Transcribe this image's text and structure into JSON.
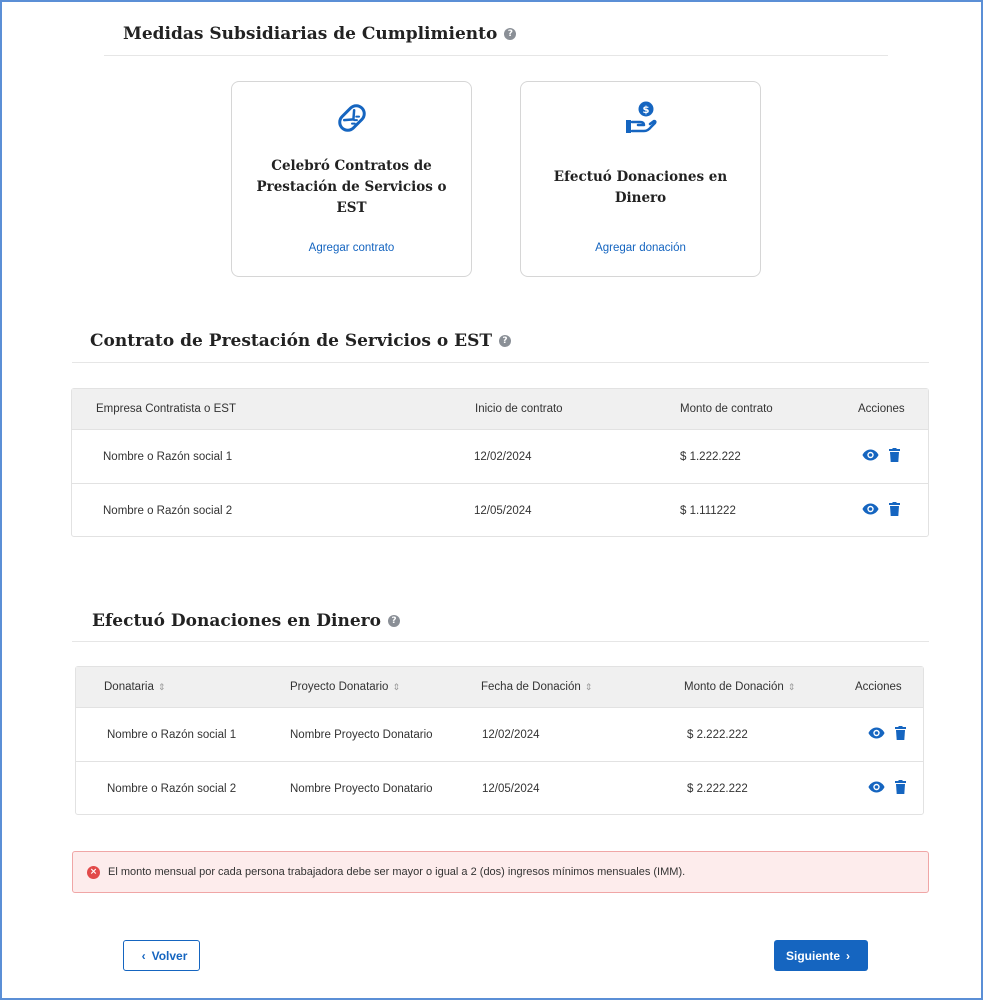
{
  "medidas": {
    "title": "Medidas Subsidiarias de Cumplimiento",
    "help_glyph": "?"
  },
  "cards": [
    {
      "title_lines": [
        "Celebró Contratos de",
        "Prestación de Servicios o",
        "EST"
      ],
      "link": "Agregar contrato",
      "icon": "handshake-icon"
    },
    {
      "title_lines": [
        "Efectuó Donaciones en",
        "Dinero"
      ],
      "link": "Agregar donación",
      "icon": "donation-hand-icon"
    }
  ],
  "contratos": {
    "title": "Contrato de Prestación de Servicios o EST",
    "headers": [
      "Empresa Contratista o EST",
      "Inicio de contrato",
      "Monto de contrato",
      "Acciones"
    ],
    "rows": [
      {
        "empresa": "Nombre o Razón social 1",
        "inicio": "12/02/2024",
        "monto": "$ 1.222.222"
      },
      {
        "empresa": "Nombre o Razón social 2",
        "inicio": "12/05/2024",
        "monto": "$ 1.111222"
      }
    ]
  },
  "donaciones": {
    "title": "Efectuó Donaciones en Dinero",
    "headers": [
      "Donataria",
      "Proyecto Donatario",
      "Fecha de Donación",
      "Monto de Donación",
      "Acciones"
    ],
    "sort_glyph": "⇕",
    "rows": [
      {
        "donataria": "Nombre o Razón social 1",
        "proyecto": "Nombre Proyecto Donatario",
        "fecha": "12/02/2024",
        "monto": "$ 2.222.222"
      },
      {
        "donataria": "Nombre o Razón social 2",
        "proyecto": "Nombre Proyecto Donatario",
        "fecha": "12/05/2024",
        "monto": "$ 2.222.222"
      }
    ]
  },
  "alert": {
    "message": "El monto mensual por cada persona trabajadora debe ser mayor o igual a 2 (dos) ingresos mínimos mensuales (IMM).",
    "glyph": "×"
  },
  "nav": {
    "back_label": "Volver",
    "next_label": "Siguiente",
    "back_glyph": "‹",
    "next_glyph": "›"
  },
  "colors": {
    "primary": "#1565c0",
    "frame": "#5b8fd6",
    "alert_bg": "#fdecec",
    "alert_border": "#f0a6a6",
    "alert_icon": "#e24a4a"
  }
}
